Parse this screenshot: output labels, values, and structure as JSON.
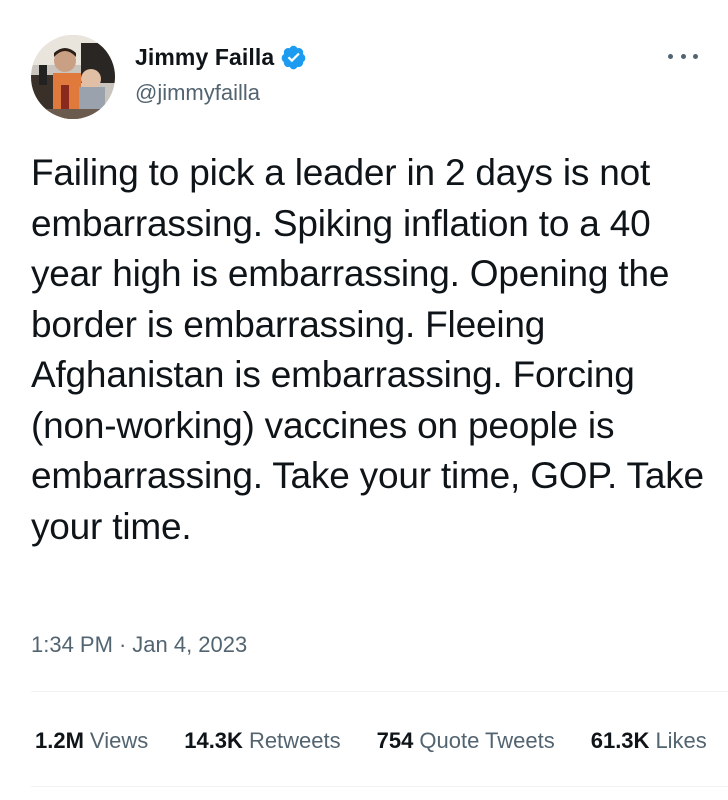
{
  "author": {
    "name": "Jimmy Failla",
    "handle": "@jimmyfailla",
    "verified": true,
    "verified_color": "#1d9bf0"
  },
  "tweet": {
    "text": "Failing to pick a leader in 2 days is not embarrassing. Spiking inflation to a 40 year high is embarrassing. Opening the border is embarrassing. Fleeing Afghanistan is embarrassing. Forcing (non-working) vaccines on people is embarrassing. Take your time, GOP. Take your time.",
    "time": "1:34 PM",
    "separator": "·",
    "date": "Jan 4, 2023"
  },
  "stats": [
    {
      "value": "1.2M",
      "label": "Views"
    },
    {
      "value": "14.3K",
      "label": "Retweets"
    },
    {
      "value": "754",
      "label": "Quote Tweets"
    },
    {
      "value": "61.3K",
      "label": "Likes"
    }
  ],
  "icons": {
    "more": "more-options-icon",
    "verified": "verified-badge-icon"
  }
}
